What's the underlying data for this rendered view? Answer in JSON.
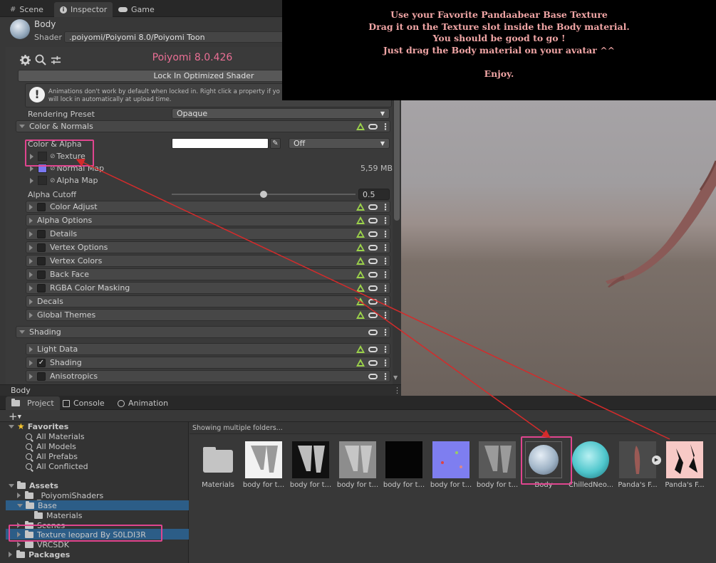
{
  "tabs": {
    "scene": "Scene",
    "inspector": "Inspector",
    "game": "Game"
  },
  "material": {
    "name": "Body",
    "shader_label": "Shader",
    "shader_value": ".poiyomi/Poiyomi 8.0/Poiyomi Toon"
  },
  "poiyomi": {
    "version_title": "Poiyomi 8.0.426",
    "lock_button": "Lock In Optimized Shader",
    "warning_line1": "Animations don't work by default when locked in. Right click a property if yo",
    "warning_line2": "will lock in automatically at upload time.",
    "rendering_preset_label": "Rendering Preset",
    "rendering_preset_value": "Opaque"
  },
  "color_normals": {
    "header": "Color & Normals",
    "color_alpha_label": "Color & Alpha",
    "dropdown_value": "Off",
    "texture_label": "Texture",
    "normal_map_label": "Normal Map",
    "normal_map_size": "5,59 MB",
    "alpha_map_label": "Alpha Map",
    "alpha_cutoff_label": "Alpha Cutoff",
    "alpha_cutoff_value": "0.5",
    "alpha_cutoff_fraction": 0.5
  },
  "sub_sections": [
    {
      "label": "Color Adjust",
      "checkbox": true
    },
    {
      "label": "Alpha Options",
      "checkbox": false
    },
    {
      "label": "Details",
      "checkbox": true
    },
    {
      "label": "Vertex Options",
      "checkbox": true
    },
    {
      "label": "Vertex Colors",
      "checkbox": true
    },
    {
      "label": "Back Face",
      "checkbox": true
    },
    {
      "label": "RGBA Color Masking",
      "checkbox": true
    },
    {
      "label": "Decals",
      "checkbox": false
    },
    {
      "label": "Global Themes",
      "checkbox": false
    }
  ],
  "shading": {
    "header": "Shading",
    "items": [
      {
        "label": "Light Data",
        "checkbox": false,
        "checked": false
      },
      {
        "label": "Shading",
        "checkbox": true,
        "checked": true
      },
      {
        "label": "Anisotropics",
        "checkbox": true,
        "checked": false
      }
    ]
  },
  "preview_bar": {
    "label": "Body"
  },
  "overlay_note": {
    "lines": [
      "Use your Favorite Pandaabear Base Texture",
      "Drag it on the Texture slot inside the Body material.",
      "You should be good to go !",
      "Just drag the Body material on your avatar ^^",
      "",
      "Enjoy."
    ]
  },
  "bottom_tabs": {
    "project": "Project",
    "console": "Console",
    "animation": "Animation"
  },
  "project_tree": {
    "add_button": "+",
    "favorites": "Favorites",
    "favorite_items": [
      "All Materials",
      "All Models",
      "All Prefabs",
      "All Conflicted"
    ],
    "assets": "Assets",
    "asset_items": [
      {
        "label": "_PoiyomiShaders",
        "indent": 1
      },
      {
        "label": "Base",
        "indent": 1,
        "selected": true
      },
      {
        "label": "Materials",
        "indent": 2
      },
      {
        "label": "Scenes",
        "indent": 1
      },
      {
        "label": "Texture leopard By S0LDI3R",
        "indent": 1,
        "selected_secondary": true
      },
      {
        "label": "VRCSDK",
        "indent": 1
      }
    ],
    "packages": "Packages"
  },
  "asset_browser": {
    "status": "Showing multiple folders...",
    "items": [
      {
        "label": "Materials",
        "kind": "folder"
      },
      {
        "label": "body for t...",
        "kind": "tex-white"
      },
      {
        "label": "body for t...",
        "kind": "tex-black"
      },
      {
        "label": "body for t...",
        "kind": "tex-gray"
      },
      {
        "label": "body for t...",
        "kind": "tex-solid-black"
      },
      {
        "label": "body for t...",
        "kind": "tex-normal"
      },
      {
        "label": "body for t...",
        "kind": "tex-darkgray"
      },
      {
        "label": "Body",
        "kind": "material-body"
      },
      {
        "label": "ChilledNeo...",
        "kind": "material-cyan"
      },
      {
        "label": "Panda's F...",
        "kind": "model"
      },
      {
        "label": "Panda's F...",
        "kind": "tex-pink"
      }
    ]
  },
  "colors": {
    "accent_pink": "#e0458f",
    "title_pink": "#ea6f95",
    "warning_green": "#9cd34a",
    "arrow_red": "#d42b2b",
    "selection_blue": "#2c5d87"
  }
}
